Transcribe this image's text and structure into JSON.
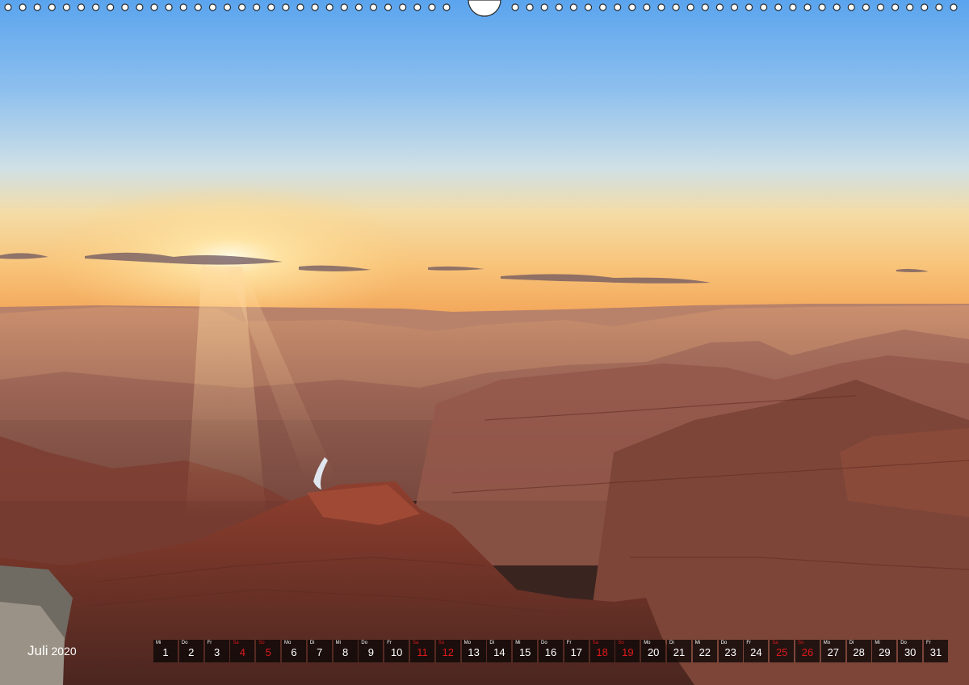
{
  "calendar": {
    "month": "Juli",
    "year": "2020",
    "days": [
      {
        "wd": "Mi",
        "d": "1",
        "we": false
      },
      {
        "wd": "Do",
        "d": "2",
        "we": false
      },
      {
        "wd": "Fr",
        "d": "3",
        "we": false
      },
      {
        "wd": "Sa",
        "d": "4",
        "we": true
      },
      {
        "wd": "So",
        "d": "5",
        "we": true
      },
      {
        "wd": "Mo",
        "d": "6",
        "we": false
      },
      {
        "wd": "Di",
        "d": "7",
        "we": false
      },
      {
        "wd": "Mi",
        "d": "8",
        "we": false
      },
      {
        "wd": "Do",
        "d": "9",
        "we": false
      },
      {
        "wd": "Fr",
        "d": "10",
        "we": false
      },
      {
        "wd": "Sa",
        "d": "11",
        "we": true
      },
      {
        "wd": "So",
        "d": "12",
        "we": true
      },
      {
        "wd": "Mo",
        "d": "13",
        "we": false
      },
      {
        "wd": "Di",
        "d": "14",
        "we": false
      },
      {
        "wd": "Mi",
        "d": "15",
        "we": false
      },
      {
        "wd": "Do",
        "d": "16",
        "we": false
      },
      {
        "wd": "Fr",
        "d": "17",
        "we": false
      },
      {
        "wd": "Sa",
        "d": "18",
        "we": true
      },
      {
        "wd": "So",
        "d": "19",
        "we": true
      },
      {
        "wd": "Mo",
        "d": "20",
        "we": false
      },
      {
        "wd": "Di",
        "d": "21",
        "we": false
      },
      {
        "wd": "Mi",
        "d": "22",
        "we": false
      },
      {
        "wd": "Do",
        "d": "23",
        "we": false
      },
      {
        "wd": "Fr",
        "d": "24",
        "we": false
      },
      {
        "wd": "Sa",
        "d": "25",
        "we": true
      },
      {
        "wd": "So",
        "d": "26",
        "we": true
      },
      {
        "wd": "Mo",
        "d": "27",
        "we": false
      },
      {
        "wd": "Di",
        "d": "28",
        "we": false
      },
      {
        "wd": "Mi",
        "d": "29",
        "we": false
      },
      {
        "wd": "Do",
        "d": "30",
        "we": false
      },
      {
        "wd": "Fr",
        "d": "31",
        "we": false
      }
    ]
  },
  "colors": {
    "weekday_text": "#ffffff",
    "weekend_text": "#e0191c",
    "cell_background": "#0a0606"
  },
  "photo": {
    "subject": "canyon-sunset-landscape"
  }
}
